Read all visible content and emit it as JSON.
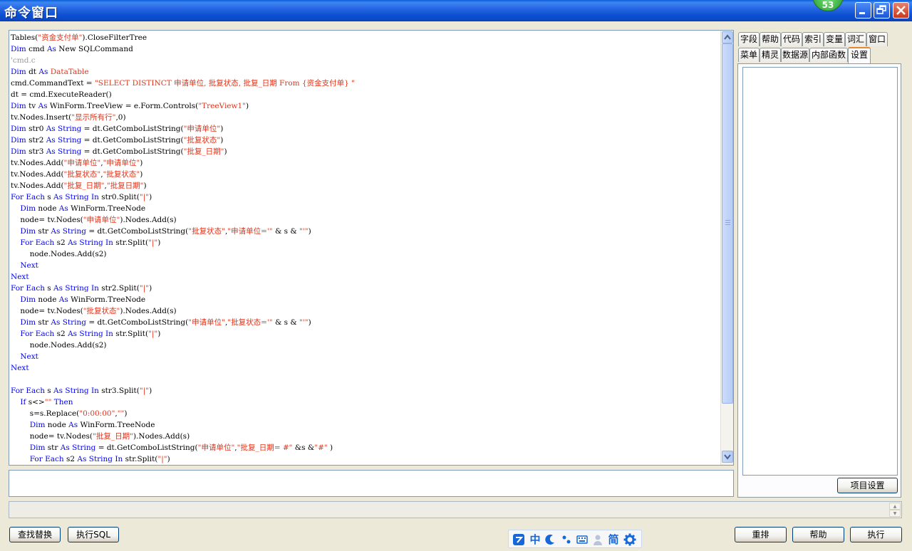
{
  "window": {
    "title": "命令窗口",
    "badge": "53"
  },
  "code_lines": [
    [
      [
        "t",
        "Tables("
      ],
      [
        "s",
        "\"资金支付单\""
      ],
      [
        "t",
        ").CloseFilterTree"
      ]
    ],
    [
      [
        "k",
        "Dim"
      ],
      [
        "t",
        " cmd "
      ],
      [
        "k",
        "As"
      ],
      [
        "t",
        " New SQLCommand"
      ]
    ],
    [
      [
        "c",
        "'cmd.c"
      ]
    ],
    [
      [
        "k",
        "Dim"
      ],
      [
        "t",
        " dt "
      ],
      [
        "k",
        "As"
      ],
      [
        "t",
        " "
      ],
      [
        "s",
        "DataTable"
      ]
    ],
    [
      [
        "t",
        "cmd.CommandText = "
      ],
      [
        "s",
        "\"SELECT DISTINCT 申请单位, 批复状态, 批复_日期 From {资金支付单} \""
      ]
    ],
    [
      [
        "t",
        "dt = cmd.ExecuteReader()"
      ]
    ],
    [
      [
        "k",
        "Dim"
      ],
      [
        "t",
        " tv "
      ],
      [
        "k",
        "As"
      ],
      [
        "t",
        " WinForm.TreeView = e.Form.Controls("
      ],
      [
        "s",
        "\"TreeView1\""
      ],
      [
        "t",
        ")"
      ]
    ],
    [
      [
        "t",
        "tv.Nodes.Insert("
      ],
      [
        "s",
        "\"显示所有行\""
      ],
      [
        "t",
        ",0)"
      ]
    ],
    [
      [
        "k",
        "Dim"
      ],
      [
        "t",
        " str0 "
      ],
      [
        "k",
        "As"
      ],
      [
        "t",
        " "
      ],
      [
        "k",
        "String"
      ],
      [
        "t",
        " = dt.GetComboListString("
      ],
      [
        "s",
        "\"申请单位\""
      ],
      [
        "t",
        ")"
      ]
    ],
    [
      [
        "k",
        "Dim"
      ],
      [
        "t",
        " str2 "
      ],
      [
        "k",
        "As"
      ],
      [
        "t",
        " "
      ],
      [
        "k",
        "String"
      ],
      [
        "t",
        " = dt.GetComboListString("
      ],
      [
        "s",
        "\"批复状态\""
      ],
      [
        "t",
        ")"
      ]
    ],
    [
      [
        "k",
        "Dim"
      ],
      [
        "t",
        " str3 "
      ],
      [
        "k",
        "As"
      ],
      [
        "t",
        " "
      ],
      [
        "k",
        "String"
      ],
      [
        "t",
        " = dt.GetComboListString("
      ],
      [
        "s",
        "\"批复_日期\""
      ],
      [
        "t",
        ")"
      ]
    ],
    [
      [
        "t",
        "tv.Nodes.Add("
      ],
      [
        "s",
        "\"申请单位\""
      ],
      [
        "t",
        ","
      ],
      [
        "s",
        "\"申请单位\""
      ],
      [
        "t",
        ")"
      ]
    ],
    [
      [
        "t",
        "tv.Nodes.Add("
      ],
      [
        "s",
        "\"批复状态\""
      ],
      [
        "t",
        ","
      ],
      [
        "s",
        "\"批复状态\""
      ],
      [
        "t",
        ")"
      ]
    ],
    [
      [
        "t",
        "tv.Nodes.Add("
      ],
      [
        "s",
        "\"批复_日期\""
      ],
      [
        "t",
        ","
      ],
      [
        "s",
        "\"批复日期\""
      ],
      [
        "t",
        ")"
      ]
    ],
    [
      [
        "k",
        "For Each"
      ],
      [
        "t",
        " s "
      ],
      [
        "k",
        "As"
      ],
      [
        "t",
        " "
      ],
      [
        "k",
        "String"
      ],
      [
        "t",
        " "
      ],
      [
        "k",
        "In"
      ],
      [
        "t",
        " str0.Split("
      ],
      [
        "s",
        "\"|\""
      ],
      [
        "t",
        ")"
      ]
    ],
    [
      [
        "t",
        "    "
      ],
      [
        "k",
        "Dim"
      ],
      [
        "t",
        " node "
      ],
      [
        "k",
        "As"
      ],
      [
        "t",
        " WinForm.TreeNode"
      ]
    ],
    [
      [
        "t",
        "    node= tv.Nodes("
      ],
      [
        "s",
        "\"申请单位\""
      ],
      [
        "t",
        ").Nodes.Add(s)"
      ]
    ],
    [
      [
        "t",
        "    "
      ],
      [
        "k",
        "Dim"
      ],
      [
        "t",
        " str "
      ],
      [
        "k",
        "As"
      ],
      [
        "t",
        " "
      ],
      [
        "k",
        "String"
      ],
      [
        "t",
        " = dt.GetComboListString("
      ],
      [
        "s",
        "\"批复状态\""
      ],
      [
        "t",
        ","
      ],
      [
        "s",
        "\"申请单位='\""
      ],
      [
        "t",
        " & s & "
      ],
      [
        "s",
        "\"'\""
      ],
      [
        "t",
        ")"
      ]
    ],
    [
      [
        "t",
        "    "
      ],
      [
        "k",
        "For Each"
      ],
      [
        "t",
        " s2 "
      ],
      [
        "k",
        "As"
      ],
      [
        "t",
        " "
      ],
      [
        "k",
        "String"
      ],
      [
        "t",
        " "
      ],
      [
        "k",
        "In"
      ],
      [
        "t",
        " str.Split("
      ],
      [
        "s",
        "\"|\""
      ],
      [
        "t",
        ")"
      ]
    ],
    [
      [
        "t",
        "        node.Nodes.Add(s2)"
      ]
    ],
    [
      [
        "t",
        "    "
      ],
      [
        "k",
        "Next"
      ]
    ],
    [
      [
        "k",
        "Next"
      ]
    ],
    [
      [
        "k",
        "For Each"
      ],
      [
        "t",
        " s "
      ],
      [
        "k",
        "As"
      ],
      [
        "t",
        " "
      ],
      [
        "k",
        "String"
      ],
      [
        "t",
        " "
      ],
      [
        "k",
        "In"
      ],
      [
        "t",
        " str2.Split("
      ],
      [
        "s",
        "\"|\""
      ],
      [
        "t",
        ")"
      ]
    ],
    [
      [
        "t",
        "    "
      ],
      [
        "k",
        "Dim"
      ],
      [
        "t",
        " node "
      ],
      [
        "k",
        "As"
      ],
      [
        "t",
        " WinForm.TreeNode"
      ]
    ],
    [
      [
        "t",
        "    node= tv.Nodes("
      ],
      [
        "s",
        "\"批复状态\""
      ],
      [
        "t",
        ").Nodes.Add(s)"
      ]
    ],
    [
      [
        "t",
        "    "
      ],
      [
        "k",
        "Dim"
      ],
      [
        "t",
        " str "
      ],
      [
        "k",
        "As"
      ],
      [
        "t",
        " "
      ],
      [
        "k",
        "String"
      ],
      [
        "t",
        " = dt.GetComboListString("
      ],
      [
        "s",
        "\"申请单位\""
      ],
      [
        "t",
        ","
      ],
      [
        "s",
        "\"批复状态='\""
      ],
      [
        "t",
        " & s & "
      ],
      [
        "s",
        "\"'\""
      ],
      [
        "t",
        ")"
      ]
    ],
    [
      [
        "t",
        "    "
      ],
      [
        "k",
        "For Each"
      ],
      [
        "t",
        " s2 "
      ],
      [
        "k",
        "As"
      ],
      [
        "t",
        " "
      ],
      [
        "k",
        "String"
      ],
      [
        "t",
        " "
      ],
      [
        "k",
        "In"
      ],
      [
        "t",
        " str.Split("
      ],
      [
        "s",
        "\"|\""
      ],
      [
        "t",
        ")"
      ]
    ],
    [
      [
        "t",
        "        node.Nodes.Add(s2)"
      ]
    ],
    [
      [
        "t",
        "    "
      ],
      [
        "k",
        "Next"
      ]
    ],
    [
      [
        "k",
        "Next"
      ]
    ],
    [],
    [
      [
        "k",
        "For Each"
      ],
      [
        "t",
        " s "
      ],
      [
        "k",
        "As"
      ],
      [
        "t",
        " "
      ],
      [
        "k",
        "String"
      ],
      [
        "t",
        " "
      ],
      [
        "k",
        "In"
      ],
      [
        "t",
        " str3.Split("
      ],
      [
        "s",
        "\"|\""
      ],
      [
        "t",
        ")"
      ]
    ],
    [
      [
        "t",
        "    "
      ],
      [
        "k",
        "If"
      ],
      [
        "t",
        " s<>"
      ],
      [
        "s",
        "\"\""
      ],
      [
        "t",
        " "
      ],
      [
        "k",
        "Then"
      ]
    ],
    [
      [
        "t",
        "        s=s.Replace("
      ],
      [
        "s",
        "\"0:00:00\""
      ],
      [
        "t",
        ","
      ],
      [
        "s",
        "\"\""
      ],
      [
        "t",
        ")"
      ]
    ],
    [
      [
        "t",
        "        "
      ],
      [
        "k",
        "Dim"
      ],
      [
        "t",
        " node "
      ],
      [
        "k",
        "As"
      ],
      [
        "t",
        " WinForm.TreeNode"
      ]
    ],
    [
      [
        "t",
        "        node= tv.Nodes("
      ],
      [
        "s",
        "\"批复_日期\""
      ],
      [
        "t",
        ").Nodes.Add(s)"
      ]
    ],
    [
      [
        "t",
        "        "
      ],
      [
        "k",
        "Dim"
      ],
      [
        "t",
        " str "
      ],
      [
        "k",
        "As"
      ],
      [
        "t",
        " "
      ],
      [
        "k",
        "String"
      ],
      [
        "t",
        " = dt.GetComboListString("
      ],
      [
        "s",
        "\"申请单位\""
      ],
      [
        "t",
        ","
      ],
      [
        "s",
        "\"批复_日期= #\""
      ],
      [
        "t",
        " &s &"
      ],
      [
        "s",
        "\"#\""
      ],
      [
        "t",
        " )"
      ]
    ],
    [
      [
        "t",
        "        "
      ],
      [
        "k",
        "For Each"
      ],
      [
        "t",
        " s2 "
      ],
      [
        "k",
        "As"
      ],
      [
        "t",
        " "
      ],
      [
        "k",
        "String"
      ],
      [
        "t",
        " "
      ],
      [
        "k",
        "In"
      ],
      [
        "t",
        " str.Split("
      ],
      [
        "s",
        "\"|\""
      ],
      [
        "t",
        ")"
      ]
    ]
  ],
  "right_panel": {
    "tabs_row1": [
      "字段",
      "帮助",
      "代码",
      "索引",
      "变量",
      "词汇",
      "窗口"
    ],
    "tabs_row2": [
      "菜单",
      "精灵",
      "数据源",
      "内部函数",
      "设置"
    ],
    "active_tab": "设置",
    "project_settings_label": "项目设置"
  },
  "buttons": {
    "find_replace": "查找替换",
    "exec_sql": "执行SQL",
    "rearrange": "重排",
    "help": "帮助",
    "execute": "执行"
  },
  "ime": {
    "chinese": "中",
    "simplified": "简"
  }
}
